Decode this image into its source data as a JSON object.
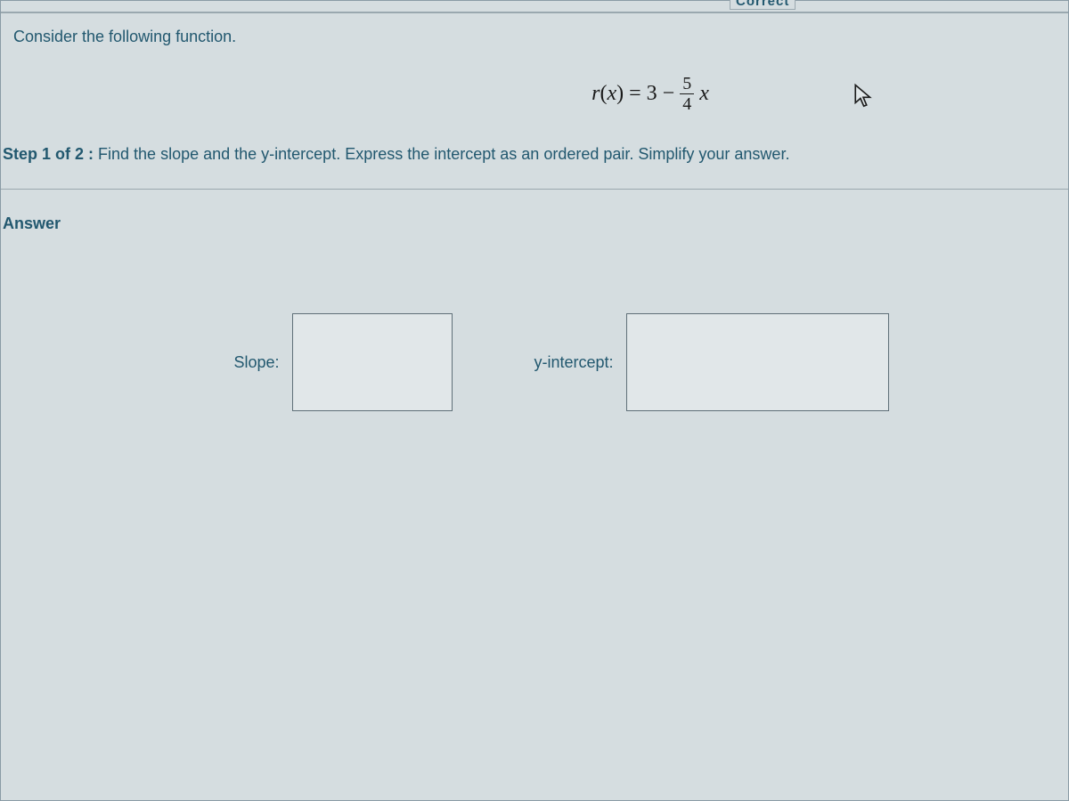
{
  "header_fragment": "Correct",
  "instruction": "Consider the following function.",
  "equation": {
    "lhs_func": "r",
    "lhs_arg_open": "(",
    "lhs_var": "x",
    "lhs_arg_close": ")",
    "equals": "=",
    "const": "3",
    "minus": "−",
    "frac_num": "5",
    "frac_den": "4",
    "trailing_var": "x"
  },
  "step": {
    "label": "Step 1 of 2 :",
    "text": "Find the slope and the y-intercept.  Express the intercept as an ordered pair. Simplify your answer."
  },
  "answer_label": "Answer",
  "fields": {
    "slope_label": "Slope:",
    "slope_value": "",
    "intercept_label": "y-intercept:",
    "intercept_value": ""
  }
}
